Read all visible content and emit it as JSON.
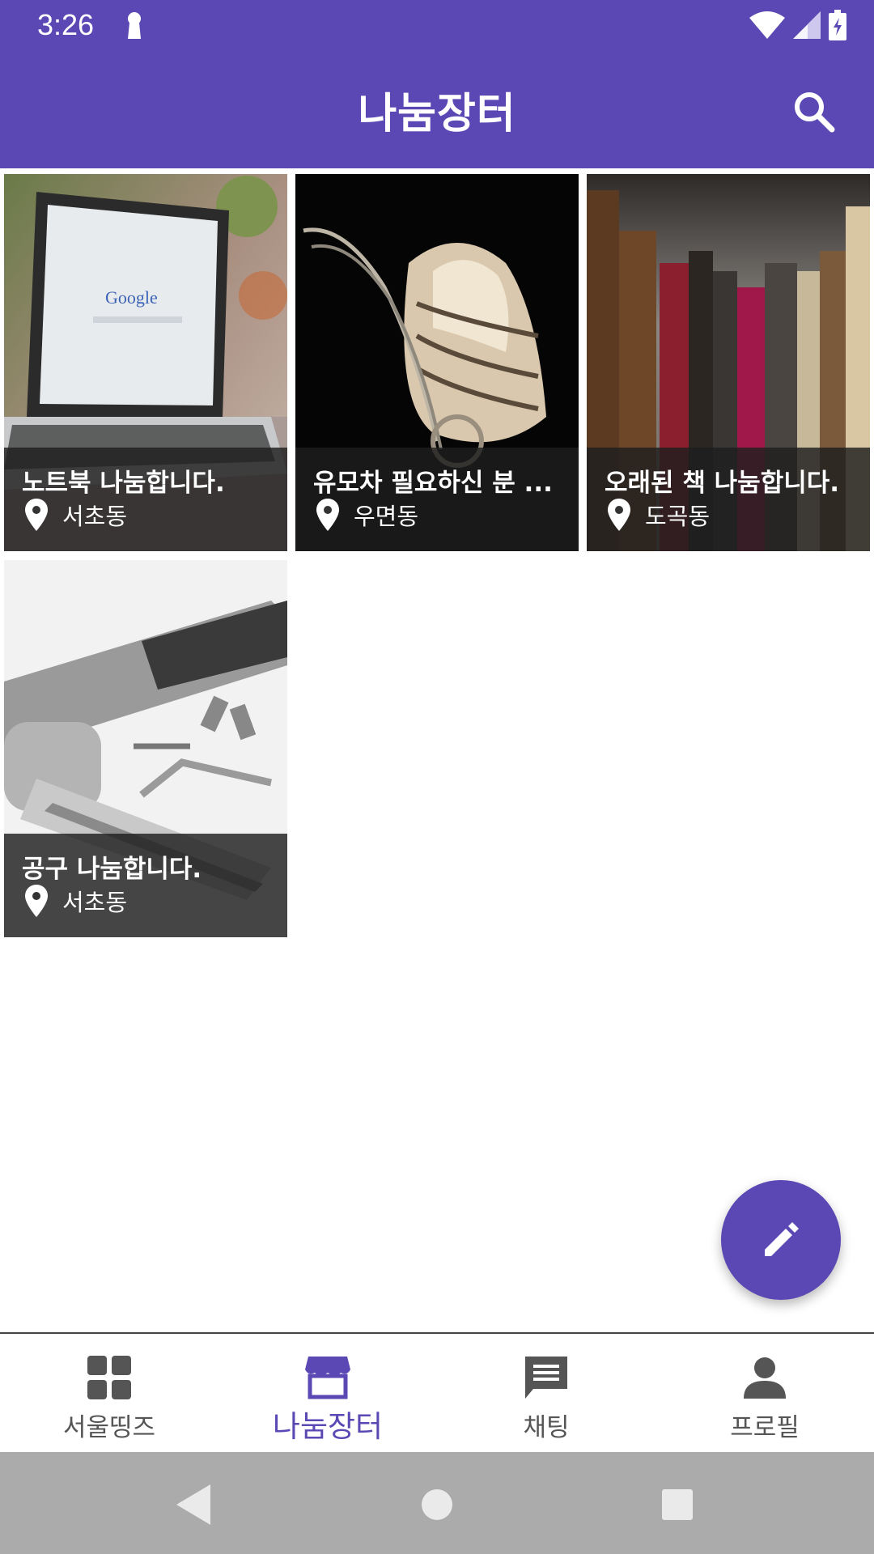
{
  "status_bar": {
    "time": "3:26"
  },
  "app_bar": {
    "title": "나눔장터"
  },
  "listings": [
    {
      "title": "노트북 나눔합니다.",
      "location": "서초동",
      "image": "laptop"
    },
    {
      "title": "유모차 필요하신 분 ...",
      "location": "우면동",
      "image": "baby-stroller"
    },
    {
      "title": "오래된 책 나눔합니다.",
      "location": "도곡동",
      "image": "old-books"
    },
    {
      "title": "공구 나눔합니다.",
      "location": "서초동",
      "image": "tools"
    }
  ],
  "bottom_nav": {
    "items": [
      {
        "label": "서울띵즈",
        "icon": "grid-icon",
        "active": false
      },
      {
        "label": "나눔장터",
        "icon": "storefront-icon",
        "active": true
      },
      {
        "label": "채팅",
        "icon": "chat-icon",
        "active": false
      },
      {
        "label": "프로필",
        "icon": "person-icon",
        "active": false
      }
    ]
  },
  "colors": {
    "primary": "#5b48b4",
    "nav_inactive": "#555555",
    "caption_bg": "#1e1e1e"
  }
}
